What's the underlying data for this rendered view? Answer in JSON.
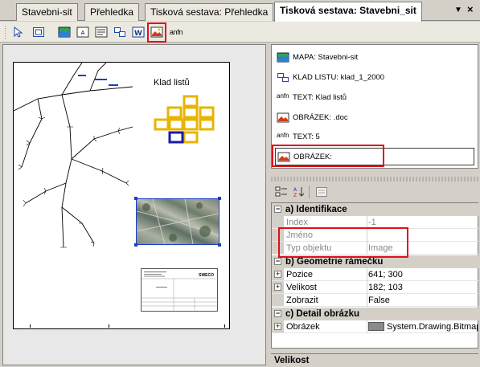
{
  "tabs": [
    {
      "label": "Stavebni-sit"
    },
    {
      "label": "Přehledka"
    },
    {
      "label": "Tisková sestava: Přehledka"
    },
    {
      "label": "Tisková sestava: Stavebni_sit"
    }
  ],
  "tab_controls": {
    "menu": "▼",
    "close": "×"
  },
  "toolbar": {
    "tools": [
      {
        "icon": "pointer-icon"
      },
      {
        "icon": "fit-page-icon"
      },
      {
        "icon": "map-icon"
      },
      {
        "icon": "abc-text-icon"
      },
      {
        "icon": "text-box-icon"
      },
      {
        "icon": "grid-icon"
      },
      {
        "icon": "word-icon"
      },
      {
        "icon": "image-icon"
      },
      {
        "icon": "anfn-text-icon"
      }
    ],
    "anfn_label": "anfn"
  },
  "page": {
    "legend_title": "Klad listů",
    "title_block_logo": "SWECO"
  },
  "object_list": [
    {
      "icon": "map-icon",
      "label": "MAPA: Stavebni-sit"
    },
    {
      "icon": "grid-icon",
      "label": "KLAD LISTU: klad_1_2000"
    },
    {
      "icon": "anfn-text-icon",
      "label": "TEXT: Klad listů"
    },
    {
      "icon": "image-icon",
      "label": "OBRÁZEK: .doc"
    },
    {
      "icon": "anfn-text-icon",
      "label": "TEXT: 5"
    },
    {
      "icon": "image-icon",
      "label": "OBRÁZEK:"
    }
  ],
  "properties": {
    "categories": [
      {
        "label": "a) Identifikace"
      },
      {
        "label": "b) Geometrie rámečku"
      },
      {
        "label": "c) Detail obrázku"
      }
    ],
    "rows": [
      {
        "name": "Index",
        "value": "-1"
      },
      {
        "name": "Jméno",
        "value": ""
      },
      {
        "name": "Typ objektu",
        "value": "Image"
      },
      {
        "name": "Pozice",
        "value": "641; 300"
      },
      {
        "name": "Velikost",
        "value": "182; 103"
      },
      {
        "name": "Zobrazit",
        "value": "False"
      },
      {
        "name": "Obrázek",
        "value": "System.Drawing.Bitmap"
      }
    ]
  },
  "description_bar": "Velikost",
  "colors": {
    "highlight": "#e0101a",
    "selected_object": "#1a3cc8",
    "legend_tiles": "#e8b400"
  }
}
